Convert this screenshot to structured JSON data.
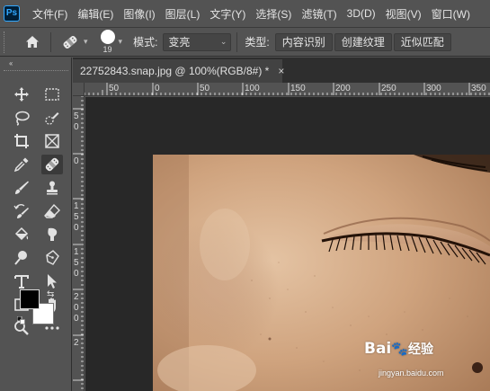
{
  "app": {
    "logo_text": "Ps"
  },
  "menu": {
    "items": [
      "文件(F)",
      "编辑(E)",
      "图像(I)",
      "图层(L)",
      "文字(Y)",
      "选择(S)",
      "滤镜(T)",
      "3D(D)",
      "视图(V)",
      "窗口(W)"
    ]
  },
  "options": {
    "brush_size": "19",
    "mode_label": "模式:",
    "mode_value": "变亮",
    "type_label": "类型:",
    "type_buttons": [
      "内容识别",
      "创建纹理",
      "近似匹配"
    ]
  },
  "toolbar": {
    "collapse_glyph": "‹‹"
  },
  "document": {
    "tab_title": "22752843.snap.jpg @ 100%(RGB/8#) *",
    "close_glyph": "×"
  },
  "rulers": {
    "h_labels": [
      "50",
      "0",
      "50",
      "100",
      "150",
      "200",
      "250",
      "300",
      "350"
    ],
    "v_labels": [
      "5",
      "0",
      "5",
      "0",
      "1",
      "0",
      "1",
      "5",
      "0",
      "2",
      "0",
      "0",
      "2"
    ]
  },
  "watermark": {
    "brand": "Bai",
    "brand_tail": "经验",
    "url": "jingyan.baidu.com"
  },
  "colors": {
    "foreground": "#000000",
    "background": "#ffffff",
    "accent": "#31a8ff"
  }
}
